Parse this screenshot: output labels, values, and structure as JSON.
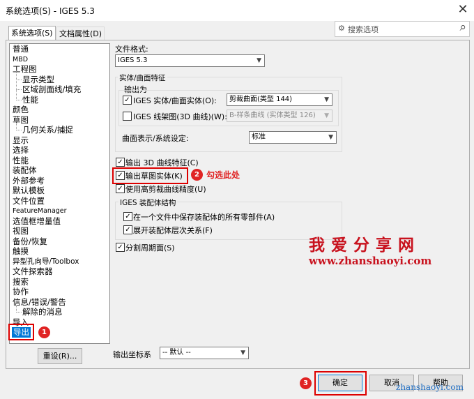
{
  "window": {
    "title": "系统选项(S) - IGES 5.3",
    "close_glyph": "✕"
  },
  "tabs": [
    {
      "label": "系统选项(S)"
    },
    {
      "label": "文档属性(D)"
    }
  ],
  "search": {
    "placeholder": "搜索选项",
    "glyph": "⌕"
  },
  "tree": {
    "items": [
      {
        "label": "普通"
      },
      {
        "label": "MBD"
      },
      {
        "label": "工程图"
      },
      {
        "label": "显示类型"
      },
      {
        "label": "区域剖面线/填充"
      },
      {
        "label": "性能"
      },
      {
        "label": "颜色"
      },
      {
        "label": "草图"
      },
      {
        "label": "几何关系/捕捉"
      },
      {
        "label": "显示"
      },
      {
        "label": "选择"
      },
      {
        "label": "性能"
      },
      {
        "label": "装配体"
      },
      {
        "label": "外部参考"
      },
      {
        "label": "默认模板"
      },
      {
        "label": "文件位置"
      },
      {
        "label": "FeatureManager"
      },
      {
        "label": "选值框增量值"
      },
      {
        "label": "视图"
      },
      {
        "label": "备份/恢复"
      },
      {
        "label": "触摸"
      },
      {
        "label": "异型孔向导/Toolbox"
      },
      {
        "label": "文件探索器"
      },
      {
        "label": "搜索"
      },
      {
        "label": "协作"
      },
      {
        "label": "信息/错误/警告"
      },
      {
        "label": "解除的消息"
      },
      {
        "label": "导入"
      },
      {
        "label": "导出"
      }
    ]
  },
  "reset_button": "重设(R)...",
  "file_format": {
    "label": "文件格式:",
    "value": "IGES 5.3"
  },
  "solid_surface": {
    "group_title": "实体/曲面特征",
    "output_as_label": "输出为",
    "iges_solid": {
      "label": "IGES 实体/曲面实体(O):",
      "value": "剪裁曲面(类型 144)"
    },
    "iges_wire": {
      "label": "IGES 线架图(3D 曲线)(W):",
      "value": "B-样条曲线 (实体类型 126)"
    },
    "surface_rep": {
      "label": "曲面表示/系统设定:",
      "value": "标准"
    }
  },
  "options": {
    "export_3d_curves": "输出 3D 曲线特征(C)",
    "export_sketch": "输出草图实体(K)",
    "high_trim": "使用高剪裁曲线精度(U)"
  },
  "assembly": {
    "group_title": "IGES 装配体结构",
    "save_single_file": "在一个文件中保存装配体的所有零部件(A)",
    "flatten_hierarchy": "展开装配体层次关系(F)"
  },
  "split_periodic": "分割周期面(S)",
  "output_coord": {
    "label": "输出坐标系",
    "value": "-- 默认 --"
  },
  "footer": {
    "ok": "确定",
    "cancel": "取消",
    "help": "帮助"
  },
  "annotations": {
    "badge1": "1",
    "badge2": "2",
    "badge3": "3",
    "step2_text": "勾选此处"
  },
  "watermark": {
    "site_name": "我爱分享网",
    "url_main": "www.zhanshaoyi.com",
    "url_corner": "zhanshaoyi.com"
  },
  "colors": {
    "accent": "#0078d7",
    "annotation_red": "#e02323",
    "watermark_red": "#c8121e"
  }
}
